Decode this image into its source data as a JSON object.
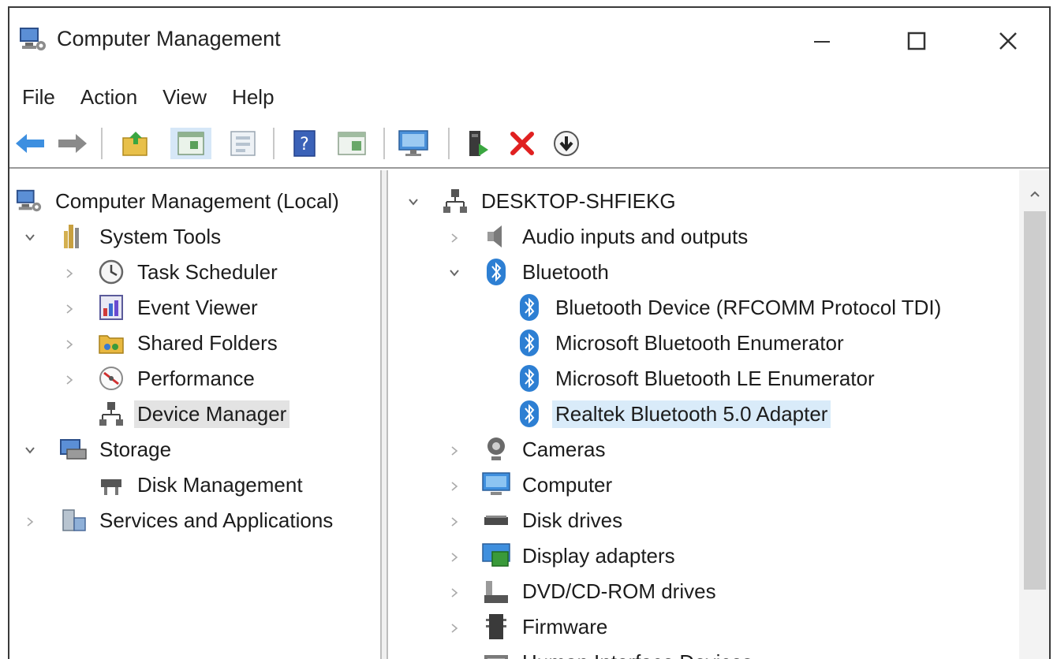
{
  "window": {
    "title": "Computer Management"
  },
  "menu": [
    "File",
    "Action",
    "View",
    "Help"
  ],
  "left_tree": {
    "root": "Computer Management (Local)",
    "system_tools": {
      "label": "System Tools",
      "children": [
        "Task Scheduler",
        "Event Viewer",
        "Shared Folders",
        "Performance",
        "Device Manager"
      ]
    },
    "storage": {
      "label": "Storage",
      "children": [
        "Disk Management"
      ]
    },
    "services": "Services and Applications"
  },
  "device_tree": {
    "computer_name": "DESKTOP-SHFIEKG",
    "categories": {
      "audio": "Audio inputs and outputs",
      "bluetooth": "Bluetooth",
      "cameras": "Cameras",
      "computer": "Computer",
      "disk_drives": "Disk drives",
      "display_adapters": "Display adapters",
      "dvd": "DVD/CD-ROM drives",
      "firmware": "Firmware",
      "hid": "Human Interface Devices"
    },
    "bluetooth_devices": [
      "Bluetooth Device (RFCOMM Protocol TDI)",
      "Microsoft Bluetooth Enumerator",
      "Microsoft Bluetooth LE Enumerator",
      "Realtek Bluetooth 5.0 Adapter"
    ]
  },
  "colors": {
    "selection_left": "#e3e3e3",
    "selection_right": "#d9ebf9",
    "bluetooth_blue": "#2d7fd3",
    "delete_red": "#e02020"
  },
  "icons": {
    "toolbar": [
      "back-arrow-icon",
      "forward-arrow-icon",
      "up-folder-icon",
      "show-hide-tree-icon",
      "properties-icon",
      "help-icon",
      "action-pane-icon",
      "monitor-icon",
      "update-driver-icon",
      "uninstall-icon",
      "scan-hardware-icon"
    ]
  }
}
